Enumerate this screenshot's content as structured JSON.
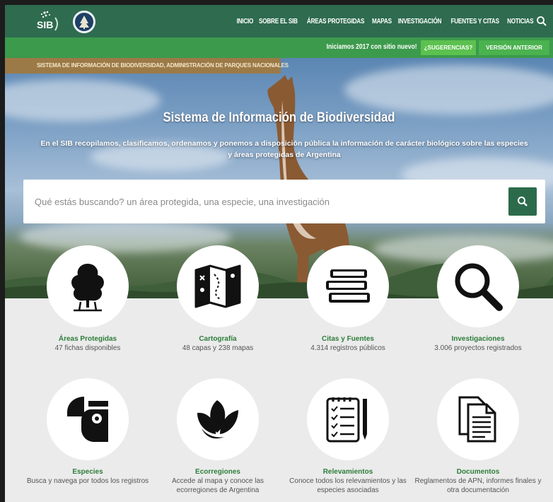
{
  "nav": {
    "items": [
      "Inicio",
      "Sobre el SIB",
      "Áreas protegidas",
      "Mapas",
      "Investigación",
      "Fuentes y citas",
      "Noticias"
    ]
  },
  "subbar": {
    "message": "Iniciamos 2017 con sitio nuevo!",
    "suggestions_label": "¿SUGERENCIAS?",
    "previous_version_label": "VERSIÓN ANTERIOR"
  },
  "hero": {
    "tagline": "Sistema de Información de Biodiversidad, Administración de Parques Nacionales",
    "title": "Sistema de Información de Biodiversidad",
    "description": "En el SIB recopilamos, clasificamos, ordenamos y ponemos a disposición pública la información de carácter biológico sobre las especies y áreas protegidas de Argentina",
    "search_placeholder": "Qué estás buscando? un área protegida, una especie, una investigación"
  },
  "tiles": [
    {
      "title": "Áreas Protegidas",
      "subtitle": "47 fichas disponibles",
      "icon": "tree-icon"
    },
    {
      "title": "Cartografía",
      "subtitle": "48 capas y 238 mapas",
      "icon": "map-icon"
    },
    {
      "title": "Citas y Fuentes",
      "subtitle": "4.314 registros públicos",
      "icon": "books-icon"
    },
    {
      "title": "Investigaciones",
      "subtitle": "3.006 proyectos registrados",
      "icon": "magnifier-icon"
    },
    {
      "title": "Especies",
      "subtitle": "Busca y navega por todos los registros",
      "icon": "species-icon"
    },
    {
      "title": "Ecorregiones",
      "subtitle": "Accede al mapa y conoce las ecorregiones de Argentina",
      "icon": "leaves-icon"
    },
    {
      "title": "Relevamientos",
      "subtitle": "Conoce todos los relevamientos y las especies asociadas",
      "icon": "checklist-icon"
    },
    {
      "title": "Documentos",
      "subtitle": "Reglamentos de APN, informes finales y otra documentación",
      "icon": "documents-icon"
    }
  ],
  "colors": {
    "nav_bg": "#2e6b4f",
    "subbar_bg": "#3c9a4c",
    "accent_green": "#2d7d3a",
    "search_button": "#2b6b4b",
    "tag_bg": "#9c7a47"
  }
}
